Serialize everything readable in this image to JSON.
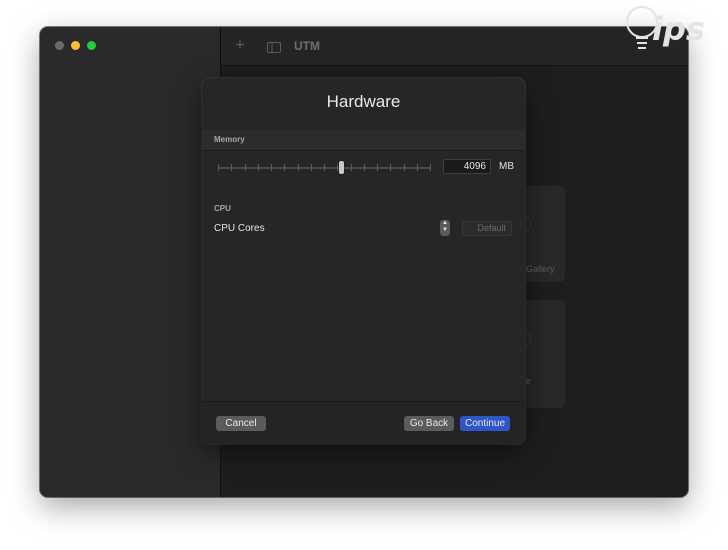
{
  "window": {
    "title": "UTM"
  },
  "background_cards": {
    "gallery_partial_text": "Gallery",
    "second_partial_text": "e"
  },
  "sheet": {
    "title": "Hardware",
    "memory": {
      "section_label": "Memory",
      "value": "4096",
      "unit": "MB",
      "slider_level": 0.58
    },
    "cpu": {
      "section_label": "CPU",
      "cores_label": "CPU Cores",
      "cores_placeholder": "Default"
    },
    "buttons": {
      "cancel": "Cancel",
      "go_back": "Go Back",
      "continue": "Continue"
    }
  },
  "colors": {
    "accent": "#2f55c7",
    "close": "#6a6a6c",
    "minimize": "#febc2e",
    "maximize": "#28c840"
  },
  "icons": {
    "add": "plus-icon",
    "sidebar_toggle": "sidebar-toggle-icon",
    "stepper": "stepper-arrows-icon"
  }
}
